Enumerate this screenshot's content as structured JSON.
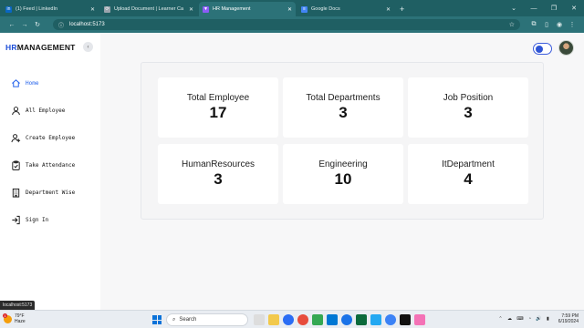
{
  "browser": {
    "tabs": [
      {
        "title": "(1) Feed | LinkedIn",
        "icon": "linkedin-icon",
        "color": "#0a66c2",
        "glyph": "in"
      },
      {
        "title": "Upload Document | Learner Ca",
        "icon": "upload-icon",
        "color": "#9aa4ad",
        "glyph": "⟳"
      },
      {
        "title": "HR Management",
        "icon": "vite-icon",
        "color": "#8b5cf6",
        "glyph": "▼"
      },
      {
        "title": "Google Docs",
        "icon": "docs-icon",
        "color": "#4285f4",
        "glyph": "≡"
      }
    ],
    "new_tab": "+",
    "url": "localhost:5173"
  },
  "app": {
    "brand_prefix": "HR",
    "brand_suffix": "MANAGEMENT",
    "collapse_glyph": "‹",
    "menu": [
      {
        "label": "Home",
        "icon": "home-icon",
        "active": true
      },
      {
        "label": "All Employee",
        "icon": "user-icon",
        "active": false
      },
      {
        "label": "Create Employee",
        "icon": "user-plus-icon",
        "active": false
      },
      {
        "label": "Take Attendance",
        "icon": "clipboard-check-icon",
        "active": false
      },
      {
        "label": "Department Wise",
        "icon": "building-icon",
        "active": false
      },
      {
        "label": "Sign In",
        "icon": "sign-in-icon",
        "active": false
      }
    ],
    "stats": [
      {
        "label": "Total Employee",
        "value": "17"
      },
      {
        "label": "Total Departments",
        "value": "3"
      },
      {
        "label": "Job Position",
        "value": "3"
      },
      {
        "label": "HumanResources",
        "value": "3"
      },
      {
        "label": "Engineering",
        "value": "10"
      },
      {
        "label": "ItDepartment",
        "value": "4"
      }
    ]
  },
  "status_url": "localhost:5173",
  "taskbar": {
    "weather_badge": "1",
    "temperature": "79°F",
    "condition": "Haze",
    "search_placeholder": "Search",
    "time": "7:59 PM",
    "date": "6/19/2024"
  },
  "colors": {
    "accent": "#2563eb",
    "chrome": "#1f5f63"
  }
}
